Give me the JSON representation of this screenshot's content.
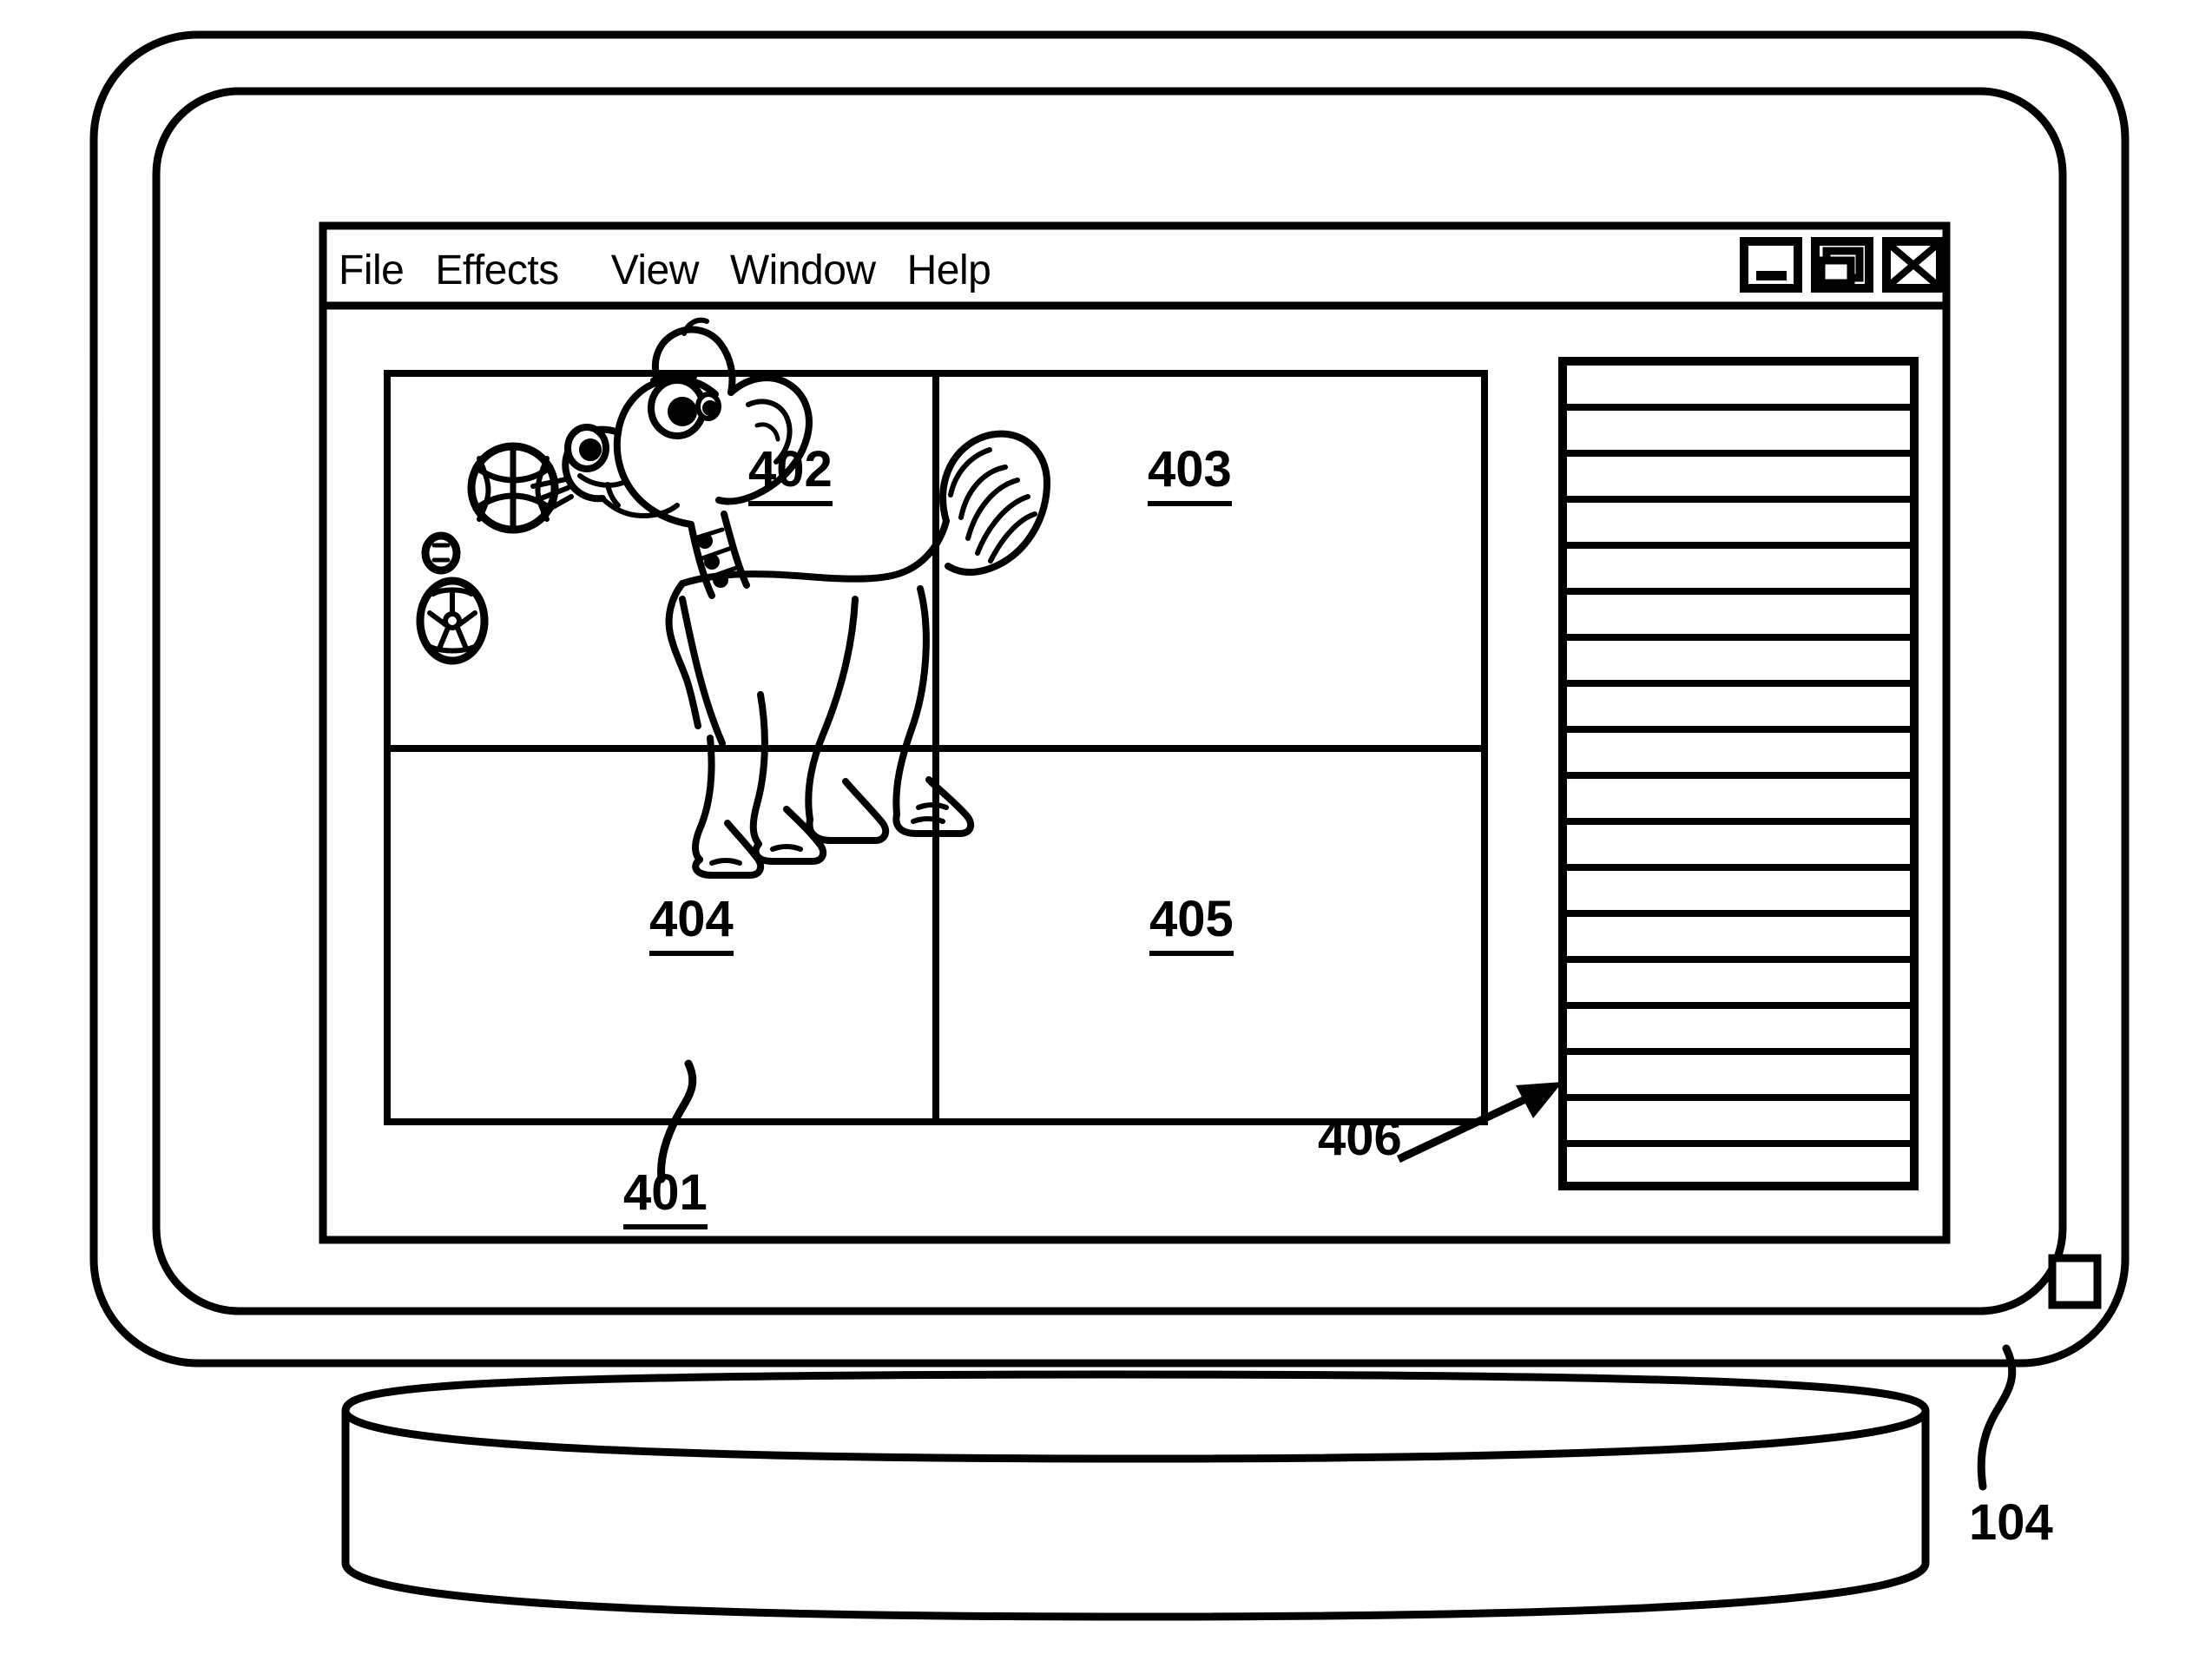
{
  "figure": {
    "device_label": "104",
    "device_name": "display-monitor"
  },
  "menubar": {
    "items": [
      {
        "label": "File",
        "name": "menu-file"
      },
      {
        "label": "Effects",
        "name": "menu-effects"
      },
      {
        "label": "View",
        "name": "menu-view"
      },
      {
        "label": "Window",
        "name": "menu-window"
      },
      {
        "label": "Help",
        "name": "menu-help"
      }
    ]
  },
  "window_controls": [
    {
      "name": "minimize-icon",
      "glyph": "minimize"
    },
    {
      "name": "restore-icon",
      "glyph": "restore"
    },
    {
      "name": "close-icon",
      "glyph": "close"
    }
  ],
  "workspace": {
    "label": "401",
    "name": "quadrant-grid",
    "quadrants": [
      {
        "label": "402",
        "name": "quadrant-top-left",
        "content": "dog-illustration"
      },
      {
        "label": "403",
        "name": "quadrant-top-right",
        "content": ""
      },
      {
        "label": "404",
        "name": "quadrant-bottom-left",
        "content": ""
      },
      {
        "label": "405",
        "name": "quadrant-bottom-right",
        "content": ""
      }
    ]
  },
  "side_panel": {
    "label": "406",
    "name": "list-panel",
    "row_count": 18,
    "rows": [
      "",
      "",
      "",
      "",
      "",
      "",
      "",
      "",
      "",
      "",
      "",
      "",
      "",
      "",
      "",
      "",
      "",
      ""
    ]
  },
  "illustration": {
    "name": "dog-illustration",
    "objects": [
      {
        "name": "basketball-icon"
      },
      {
        "name": "small-ball-icon"
      },
      {
        "name": "soccer-ball-icon"
      },
      {
        "name": "dog-figure"
      }
    ]
  },
  "colors": {
    "ink": "#000000",
    "paper": "#ffffff"
  }
}
